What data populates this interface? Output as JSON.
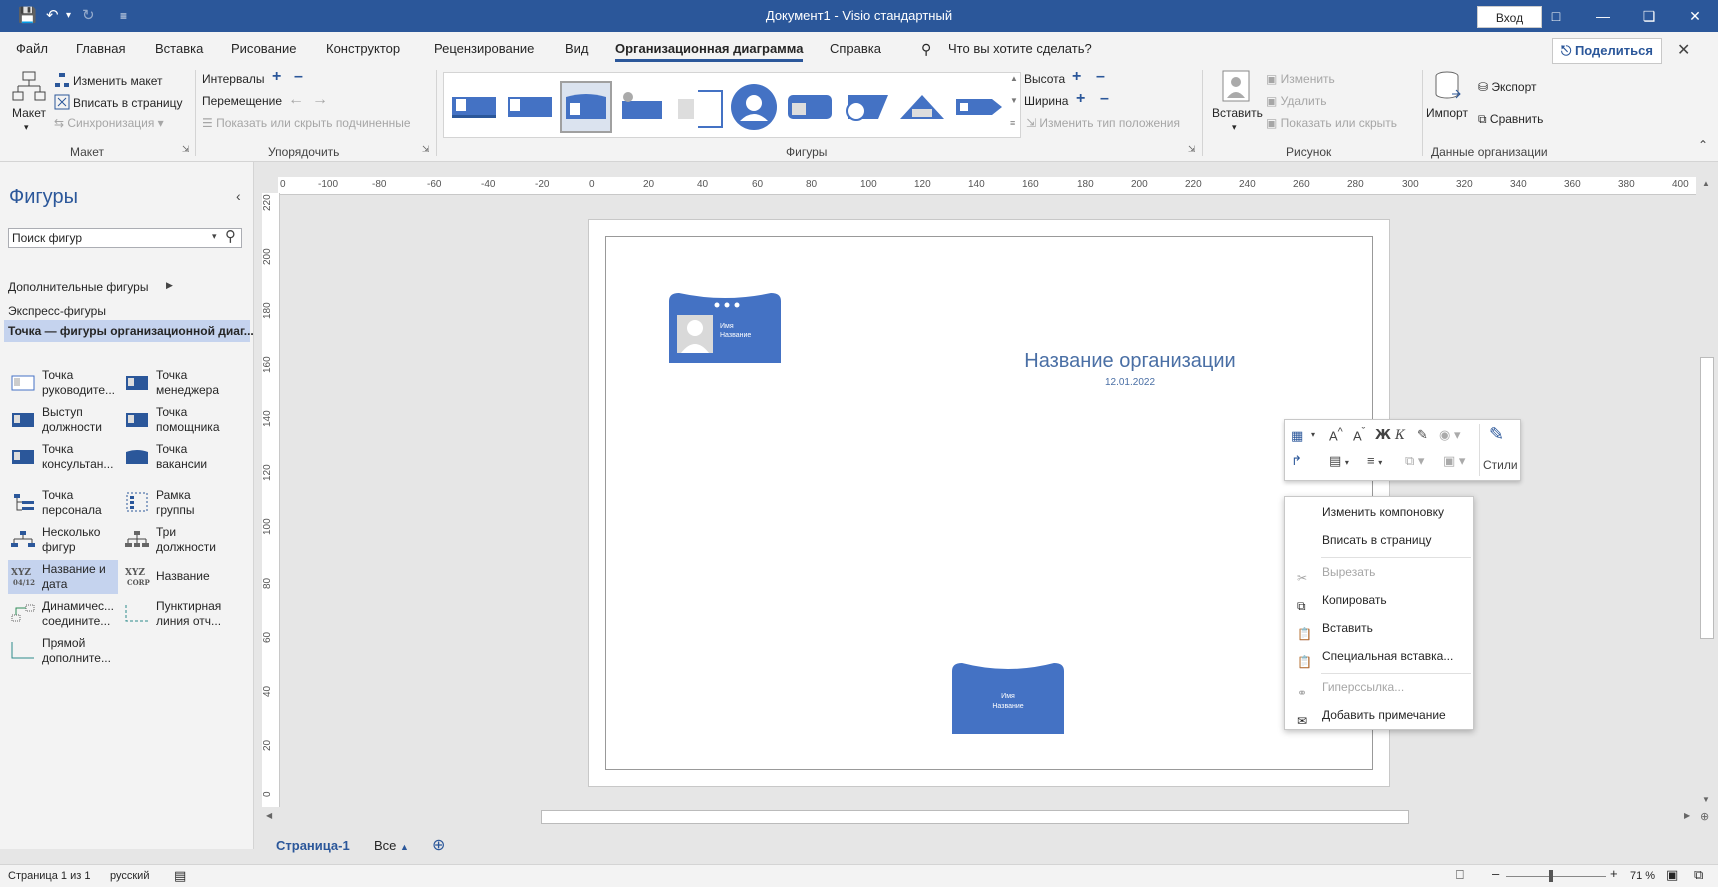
{
  "window": {
    "title": "Документ1  -  Visio стандартный",
    "signin_label": "Вход",
    "qat": {
      "undo_icon": "undo-icon",
      "redo_icon": "redo-icon"
    }
  },
  "menu": {
    "tabs": [
      "Файл",
      "Главная",
      "Вставка",
      "Рисование",
      "Конструктор",
      "Рецензирование",
      "Вид",
      "Организационная диаграмма",
      "Справка"
    ],
    "active_tab": "Организационная диаграмма",
    "tell_me": "Что вы хотите сделать?",
    "share_label": "Поделиться"
  },
  "ribbon": {
    "layout": {
      "maket_label": "Макет",
      "change_layout": "Изменить макет",
      "fit_page": "Вписать в страницу",
      "sync": "Синхронизация",
      "group_label": "Макет"
    },
    "arrange": {
      "spacing": "Интервалы",
      "move": "Перемещение",
      "show_hide_sub": "Показать или скрыть подчиненные",
      "group_label": "Упорядочить"
    },
    "shapes": {
      "height": "Высота",
      "width": "Ширина",
      "change_position_type": "Изменить тип положения",
      "group_label": "Фигуры"
    },
    "picture": {
      "insert": "Вставить",
      "change": "Изменить",
      "delete": "Удалить",
      "show_hide": "Показать или скрыть",
      "group_label": "Рисунок"
    },
    "orgdata": {
      "import": "Импорт",
      "export": "Экспорт",
      "compare": "Сравнить",
      "group_label": "Данные организации"
    }
  },
  "shapes_panel": {
    "title": "Фигуры",
    "search_placeholder": "Поиск фигур",
    "more_shapes": "Дополнительные фигуры",
    "quick_shapes": "Экспресс-фигуры",
    "active_stencil": "Точка — фигуры организационной диаг...",
    "items": [
      {
        "label": "Точка руководите..."
      },
      {
        "label": "Точка менеджера"
      },
      {
        "label": "Выступ должности"
      },
      {
        "label": "Точка помощника"
      },
      {
        "label": "Точка консультан..."
      },
      {
        "label": "Точка вакансии"
      },
      {
        "label": "Точка персонала"
      },
      {
        "label": "Рамка группы"
      },
      {
        "label": "Несколько фигур"
      },
      {
        "label": "Три должности"
      },
      {
        "label": "Название и дата"
      },
      {
        "label": "Название"
      },
      {
        "label": "Динамичес... соедините..."
      },
      {
        "label": "Пунктирная линия отч..."
      },
      {
        "label": "Прямой дополните..."
      }
    ]
  },
  "rulers": {
    "h_ticks": [
      "0",
      "-100",
      "-80",
      "-60",
      "-40",
      "-20",
      "0",
      "20",
      "40",
      "60",
      "80",
      "100",
      "120",
      "140",
      "160",
      "180",
      "200",
      "220",
      "240",
      "260",
      "280",
      "300",
      "320",
      "340",
      "360",
      "380",
      "400"
    ],
    "v_ticks": [
      "220",
      "200",
      "180",
      "160",
      "140",
      "120",
      "100",
      "80",
      "60",
      "40",
      "20",
      "0"
    ]
  },
  "drawing": {
    "org_title": "Название организации",
    "org_date": "12.01.2022",
    "card1_name": "Имя",
    "card1_title": "Название",
    "card2_name": "Имя",
    "card2_title": "Название"
  },
  "mini_toolbar": {
    "styles_label": "Стили",
    "bold": "Ж",
    "italic": "К"
  },
  "context_menu": {
    "items": [
      {
        "label": "Изменить компоновку",
        "enabled": true
      },
      {
        "label": "Вписать в страницу",
        "enabled": true
      },
      {
        "label": "Вырезать",
        "enabled": false
      },
      {
        "label": "Копировать",
        "enabled": true
      },
      {
        "label": "Вставить",
        "enabled": true
      },
      {
        "label": "Специальная вставка...",
        "enabled": true
      },
      {
        "label": "Гиперссылка...",
        "enabled": false
      },
      {
        "label": "Добавить примечание",
        "enabled": true
      }
    ]
  },
  "page_tabs": {
    "current": "Страница-1",
    "all": "Все"
  },
  "status": {
    "page": "Страница 1 из 1",
    "language": "русский",
    "zoom": "71 %",
    "zoom_level": 0.45
  },
  "colors": {
    "accent": "#2b579a",
    "shape_fill": "#4472c4"
  }
}
